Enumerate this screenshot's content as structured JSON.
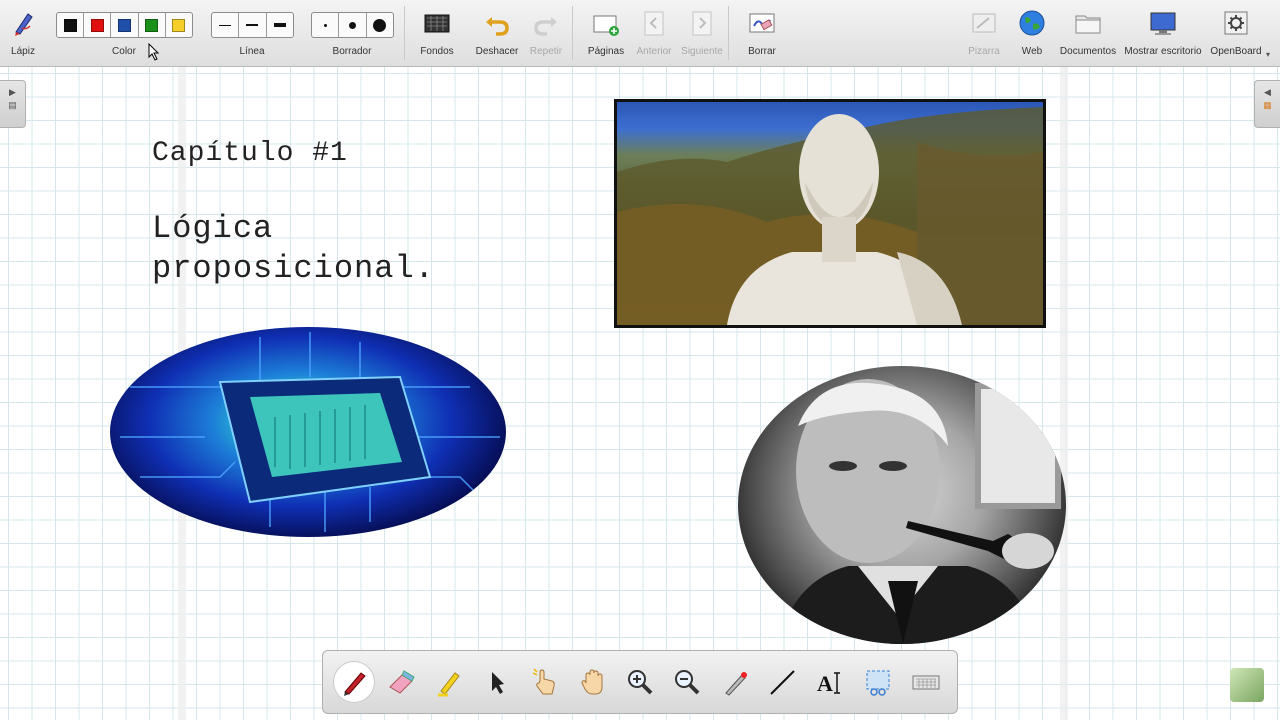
{
  "toolbar": {
    "lapiz": "Lápiz",
    "color": "Color",
    "linea": "Línea",
    "borrador": "Borrador",
    "fondos": "Fondos",
    "deshacer": "Deshacer",
    "repetir": "Repetir",
    "paginas": "Páginas",
    "anterior": "Anterior",
    "siguiente": "Siguiente",
    "borrar": "Borrar",
    "pizarra": "Pizarra",
    "web": "Web",
    "documentos": "Documentos",
    "mostrar_escritorio": "Mostrar escritorio",
    "openboard": "OpenBoard",
    "colors": [
      "#111111",
      "#e01010",
      "#1f4fa8",
      "#1a8f1a",
      "#f5d02a"
    ]
  },
  "slide": {
    "chapter": "Capítulo #1",
    "title_line1": "Lógica",
    "title_line2": "proposicional."
  },
  "icons": {
    "pen": "pen-icon",
    "eraser": "eraser-icon",
    "highlighter": "highlighter-icon",
    "select": "select-arrow-icon",
    "interact": "pointer-hand-icon",
    "pan": "pan-hand-icon",
    "zoom_in": "zoom-in-icon",
    "zoom_out": "zoom-out-icon",
    "laser": "laser-pointer-icon",
    "line": "line-tool-icon",
    "text": "text-tool-icon",
    "capture": "capture-icon",
    "keyboard": "keyboard-icon"
  }
}
